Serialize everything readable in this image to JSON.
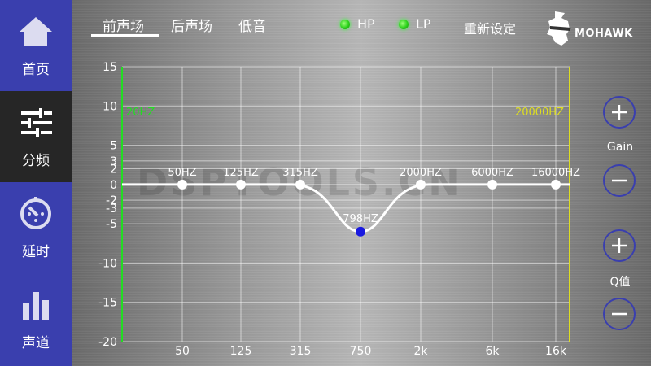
{
  "sidebar": {
    "items": [
      {
        "label": "首页",
        "icon": "home-icon"
      },
      {
        "label": "分频",
        "icon": "sliders-icon"
      },
      {
        "label": "延时",
        "icon": "timer-icon"
      },
      {
        "label": "声道",
        "icon": "bars-icon"
      }
    ],
    "active_index": 1
  },
  "tabs": [
    {
      "label": "前声场"
    },
    {
      "label": "后声场"
    },
    {
      "label": "低音"
    }
  ],
  "filters": {
    "hp_label": "HP",
    "lp_label": "LP"
  },
  "reset_label": "重新设定",
  "logo_text": "MOHAWK",
  "watermark": "DSPTOOLS.CN",
  "colors": {
    "accent": "#3a3fae",
    "hp_line": "#22dd22",
    "lp_line": "#dddd22",
    "curve": "#ffffff",
    "selected_point": "#1a1ae0"
  },
  "chart_data": {
    "type": "line",
    "y_ticks": [
      15,
      10,
      5,
      3,
      2,
      0,
      -2,
      -3,
      -5,
      -10,
      -15,
      -20
    ],
    "ylim": [
      -20,
      15
    ],
    "x_ticks": [
      "50",
      "125",
      "315",
      "750",
      "2k",
      "6k",
      "16k"
    ],
    "hp_label": "20HZ",
    "lp_label": "20000HZ",
    "bands": [
      {
        "label": "50HZ",
        "gain": 0
      },
      {
        "label": "125HZ",
        "gain": 0
      },
      {
        "label": "315HZ",
        "gain": 0
      },
      {
        "label": "798HZ",
        "gain": -6,
        "selected": true
      },
      {
        "label": "2000HZ",
        "gain": 0
      },
      {
        "label": "6000HZ",
        "gain": 0
      },
      {
        "label": "16000HZ",
        "gain": 0
      }
    ]
  },
  "gain_label": "Gain",
  "q_label": "Q值"
}
